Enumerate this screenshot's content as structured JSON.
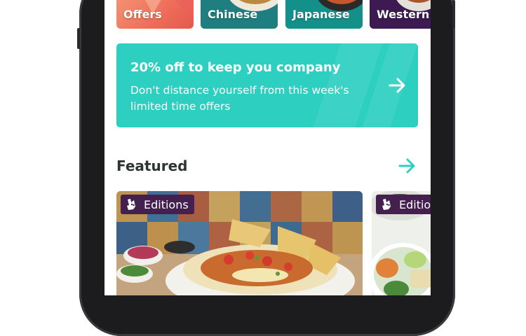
{
  "categories": [
    {
      "label": "Offers"
    },
    {
      "label": "Chinese"
    },
    {
      "label": "Japanese"
    },
    {
      "label": "Western"
    }
  ],
  "promo": {
    "title": "20% off to keep you company",
    "subtitle": "Don't distance yourself from this week's limited time offers",
    "icon": "arrow-right-icon",
    "color": "#2ccfc0"
  },
  "featured": {
    "title": "Featured",
    "icon": "arrow-right-icon",
    "accent": "#2ccfc0",
    "cards": [
      {
        "badge": "Editions",
        "badge_icon": "deliveroo-kangaroo-icon"
      },
      {
        "badge": "Editions",
        "badge_icon": "deliveroo-kangaroo-icon"
      }
    ]
  }
}
